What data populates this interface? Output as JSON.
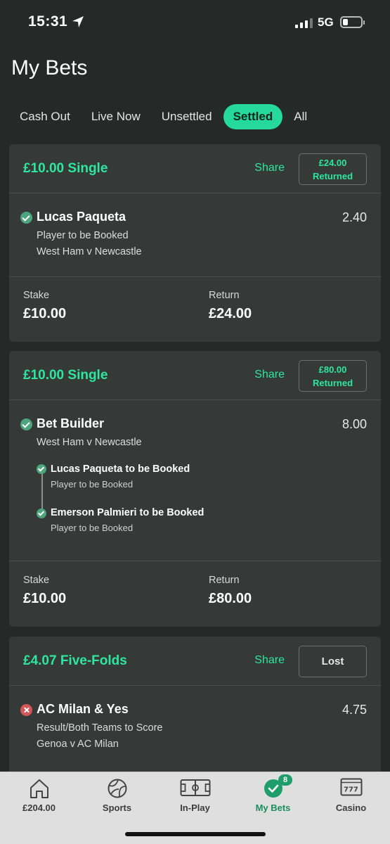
{
  "status": {
    "time": "15:31",
    "network": "5G"
  },
  "page_title": "My Bets",
  "tabs": [
    {
      "label": "Cash Out"
    },
    {
      "label": "Live Now"
    },
    {
      "label": "Unsettled"
    },
    {
      "label": "Settled",
      "active": true
    },
    {
      "label": "All"
    }
  ],
  "bets": [
    {
      "title": "£10.00 Single",
      "share": "Share",
      "result_amount": "£24.00",
      "result_label": "Returned",
      "selection": {
        "name": "Lucas Paqueta",
        "odds": "2.40",
        "market": "Player to be Booked",
        "event": "West Ham v Newcastle",
        "status": "won"
      },
      "stake_label": "Stake",
      "stake": "£10.00",
      "return_label": "Return",
      "return": "£24.00"
    },
    {
      "title": "£10.00 Single",
      "share": "Share",
      "result_amount": "£80.00",
      "result_label": "Returned",
      "selection": {
        "name": "Bet Builder",
        "odds": "8.00",
        "event": "West Ham v Newcastle",
        "status": "won"
      },
      "legs": [
        {
          "name": "Lucas Paqueta to be Booked",
          "market": "Player to be Booked"
        },
        {
          "name": "Emerson Palmieri to be Booked",
          "market": "Player to be Booked"
        }
      ],
      "stake_label": "Stake",
      "stake": "£10.00",
      "return_label": "Return",
      "return": "£80.00"
    },
    {
      "title": "£4.07 Five-Folds",
      "share": "Share",
      "result_label": "Lost",
      "selection": {
        "name": "AC Milan & Yes",
        "odds": "4.75",
        "market": "Result/Both Teams to Score",
        "event": "Genoa v AC Milan",
        "status": "lost"
      }
    }
  ],
  "bottom_nav": [
    {
      "label": "£204.00",
      "icon": "home-icon"
    },
    {
      "label": "Sports",
      "icon": "football-icon"
    },
    {
      "label": "In-Play",
      "icon": "pitch-icon"
    },
    {
      "label": "My Bets",
      "icon": "check-circle-icon",
      "badge": "8",
      "active": true
    },
    {
      "label": "Casino",
      "icon": "slot-machine-icon"
    }
  ],
  "colors": {
    "accent": "#2ee6a2",
    "tab_active": "#25d89b",
    "background": "#252927",
    "card": "#353a38",
    "won": "#4ea57d",
    "lost": "#d45757"
  }
}
